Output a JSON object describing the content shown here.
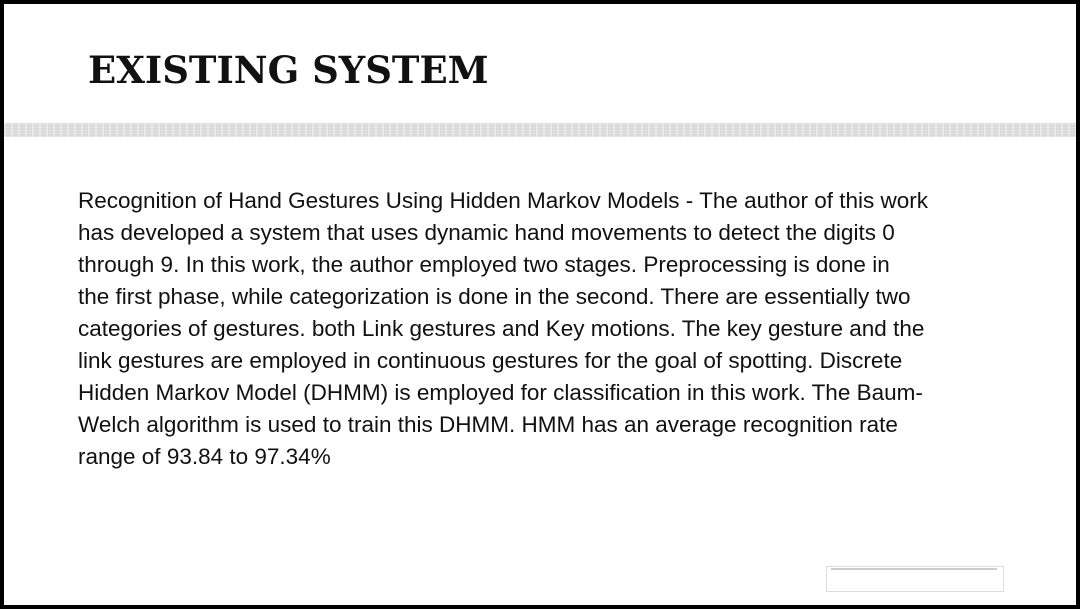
{
  "slide": {
    "title": "EXISTING SYSTEM",
    "body": "Recognition of Hand Gestures Using Hidden Markov Models - The author of this work\nhas developed a system that uses dynamic hand movements to detect the digits 0\nthrough 9. In this work, the author employed two stages. Preprocessing is done in\nthe first phase, while categorization is done in the second. There are essentially two\ncategories of gestures. both Link gestures and Key motions. The key gesture and the\nlink gestures are employed in continuous gestures for the goal of spotting. Discrete\nHidden Markov Model (DHMM) is employed for classification in this work. The Baum-\nWelch algorithm is used to train this DHMM. HMM has an average recognition rate\nrange of 93.84 to 97.34%"
  },
  "colors": {
    "frame": "#000000",
    "background": "#ffffff",
    "text": "#111111",
    "band": "#d9d9d9"
  }
}
